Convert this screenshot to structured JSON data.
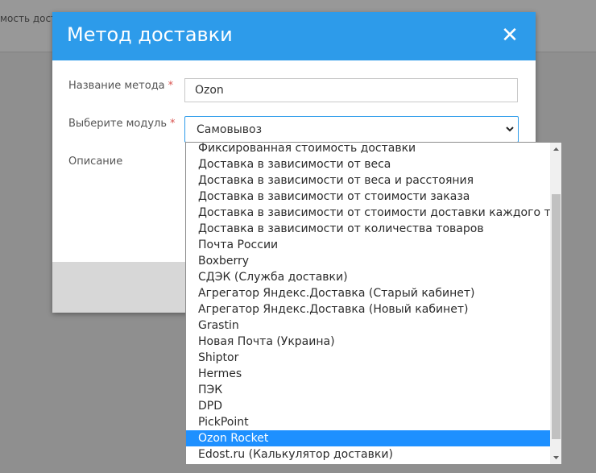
{
  "background": {
    "header_text": "мость доставки"
  },
  "modal": {
    "title": "Метод доставки",
    "close_label": "✕",
    "fields": {
      "method_name_label": "Название метода",
      "method_name_value": "Ozon",
      "module_label": "Выберите модуль",
      "module_selected": "Самовывоз",
      "description_label": "Описание",
      "required_mark": "*"
    }
  },
  "dropdown": {
    "options": [
      "Фиксированная стоимость доставки",
      "Доставка в зависимости от веса",
      "Доставка в зависимости от веса и расстояния",
      "Доставка в зависимости от стоимости заказа",
      "Доставка в зависимости от стоимости доставки каждого товара",
      "Доставка в зависимости от количества товаров",
      "Почта России",
      "Boxberry",
      "СДЭК (Служба доставки)",
      "Агрегатор Яндекс.Доставка (Старый кабинет)",
      "Агрегатор Яндекс.Доставка (Новый кабинет)",
      "Grastin",
      "Новая Почта (Украина)",
      "Shiptor",
      "Hermes",
      "ПЭК",
      "DPD",
      "PickPoint",
      "Ozon Rocket",
      "Edost.ru (Калькулятор доставки)"
    ],
    "highlighted": "Ozon Rocket"
  },
  "colors": {
    "header": "#2d9bea",
    "highlight": "#1e90ff",
    "required": "#d9534f"
  }
}
